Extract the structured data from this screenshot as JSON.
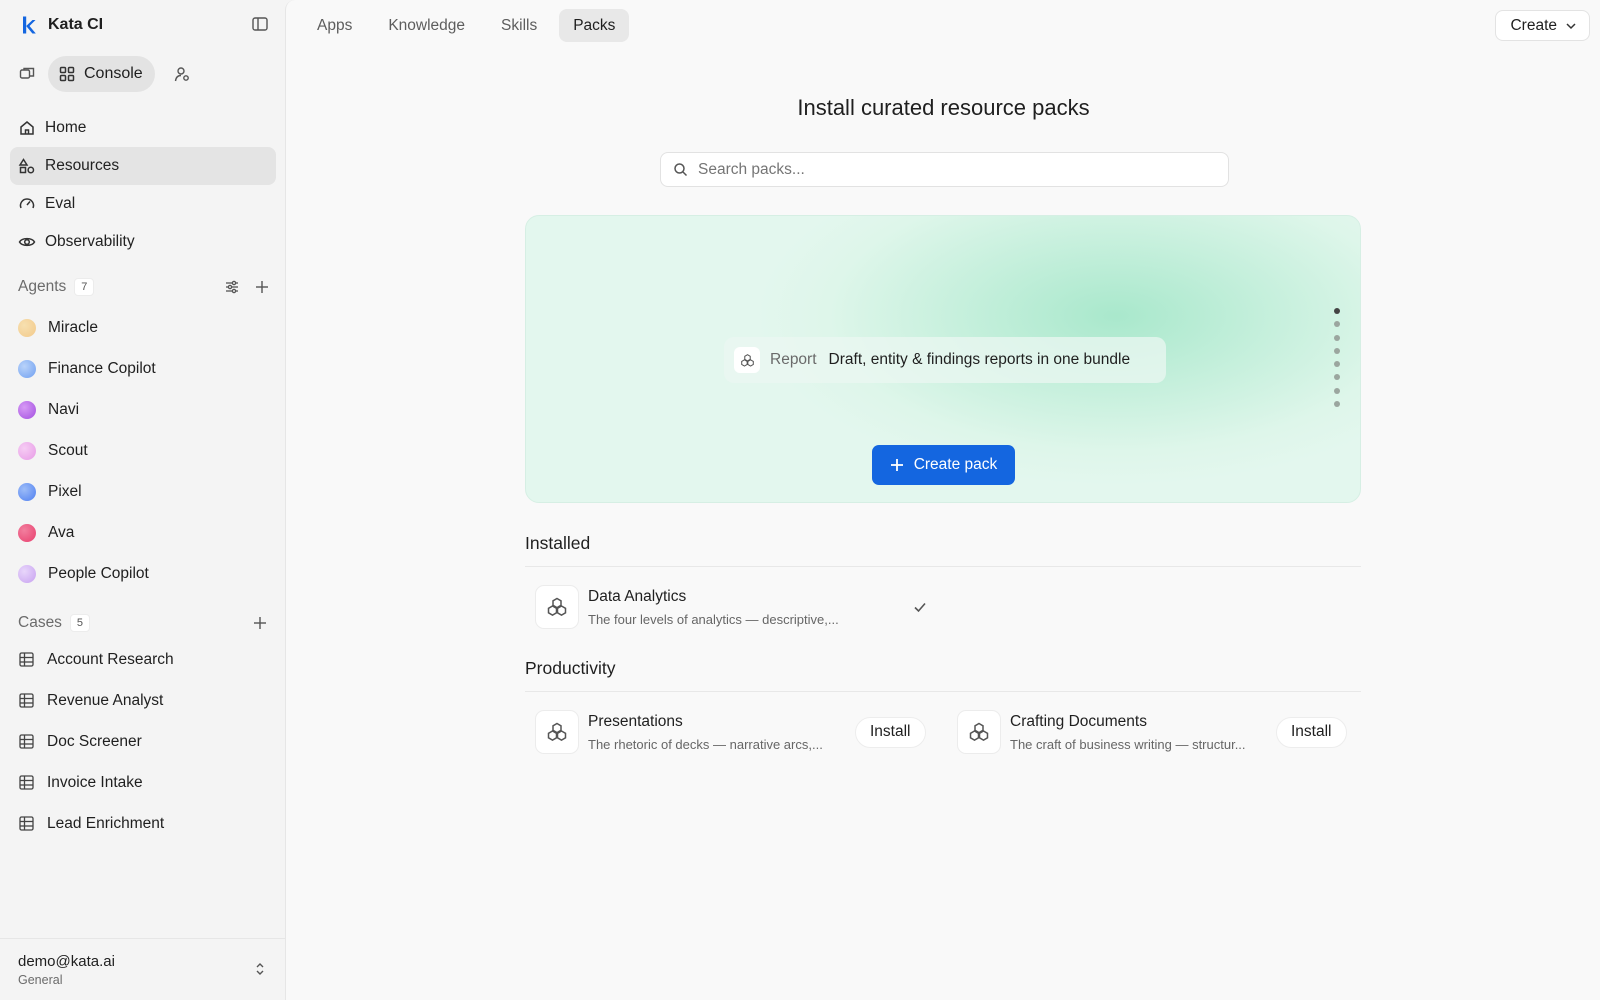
{
  "app": {
    "name": "Kata CI"
  },
  "modes": {
    "console_label": "Console"
  },
  "nav": [
    {
      "label": "Home",
      "icon": "home-icon"
    },
    {
      "label": "Resources",
      "icon": "resources-icon",
      "active": true
    },
    {
      "label": "Eval",
      "icon": "gauge-icon"
    },
    {
      "label": "Observability",
      "icon": "eye-icon"
    }
  ],
  "agents": {
    "label": "Agents",
    "count": "7",
    "items": [
      {
        "name": "Miracle",
        "color": "#f2c98a"
      },
      {
        "name": "Finance Copilot",
        "color": "#6f9ff0"
      },
      {
        "name": "Navi",
        "color": "#a24ee0"
      },
      {
        "name": "Scout",
        "color": "#e79ae6"
      },
      {
        "name": "Pixel",
        "color": "#4f7ff0"
      },
      {
        "name": "Ava",
        "color": "#e83f6e"
      },
      {
        "name": "People Copilot",
        "color": "#c7a1f0"
      }
    ]
  },
  "cases": {
    "label": "Cases",
    "count": "5",
    "items": [
      "Account Research",
      "Revenue Analyst",
      "Doc Screener",
      "Invoice Intake",
      "Lead Enrichment"
    ]
  },
  "account": {
    "email": "demo@kata.ai",
    "org": "General"
  },
  "tabs": [
    {
      "label": "Apps"
    },
    {
      "label": "Knowledge"
    },
    {
      "label": "Skills"
    },
    {
      "label": "Packs",
      "active": true
    }
  ],
  "header": {
    "create_label": "Create"
  },
  "page": {
    "title": "Install curated resource packs",
    "search_placeholder": "Search packs..."
  },
  "hero": {
    "kind": "Report",
    "description": "Draft, entity & findings reports in one bundle",
    "dots_total": 8,
    "dots_active": 1,
    "create_label": "Create pack"
  },
  "installed": {
    "title": "Installed",
    "items": [
      {
        "name": "Data Analytics",
        "description": "The four levels of analytics — descriptive,...",
        "installed": true
      }
    ]
  },
  "productivity": {
    "title": "Productivity",
    "items": [
      {
        "name": "Presentations",
        "description": "The rhetoric of decks — narrative arcs,...",
        "action": "Install"
      },
      {
        "name": "Crafting Documents",
        "description": "The craft of business writing — structur...",
        "action": "Install"
      }
    ]
  }
}
